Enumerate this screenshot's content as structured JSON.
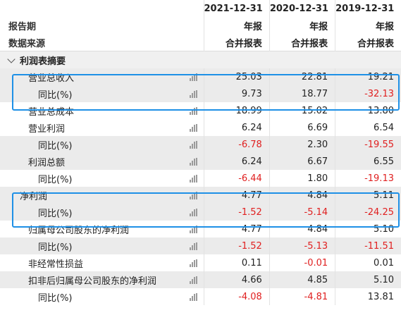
{
  "header": {
    "dates": [
      "2021-12-31",
      "2020-12-31",
      "2019-12-31"
    ],
    "period_label": "报告期",
    "period_values": [
      "年报",
      "年报",
      "年报"
    ],
    "source_label": "数据来源",
    "source_values": [
      "合并报表",
      "合并报表",
      "合并报表"
    ]
  },
  "section": {
    "title": "利润表摘要"
  },
  "rows": [
    {
      "label": "营业总收入",
      "values": [
        "25.03",
        "22.81",
        "19.21"
      ]
    },
    {
      "label": "同比(%)",
      "values": [
        "9.73",
        "18.77",
        "-32.13"
      ]
    },
    {
      "label": "营业总成本",
      "values": [
        "18.99",
        "15.02",
        "13.80"
      ]
    },
    {
      "label": "营业利润",
      "values": [
        "6.24",
        "6.69",
        "6.54"
      ]
    },
    {
      "label": "同比(%)",
      "values": [
        "-6.78",
        "2.30",
        "-19.55"
      ]
    },
    {
      "label": "利润总额",
      "values": [
        "6.24",
        "6.67",
        "6.55"
      ]
    },
    {
      "label": "同比(%)",
      "values": [
        "-6.44",
        "1.80",
        "-19.13"
      ]
    },
    {
      "label": "净利润",
      "values": [
        "4.77",
        "4.84",
        "5.11"
      ]
    },
    {
      "label": "同比(%)",
      "values": [
        "-1.52",
        "-5.14",
        "-24.25"
      ]
    },
    {
      "label": "归属母公司股东的净利润",
      "values": [
        "4.77",
        "4.84",
        "5.10"
      ]
    },
    {
      "label": "同比(%)",
      "values": [
        "-1.52",
        "-5.13",
        "-11.51"
      ]
    },
    {
      "label": "非经常性损益",
      "values": [
        "0.11",
        "-0.01",
        "0.01"
      ]
    },
    {
      "label": "扣非后归属母公司股东的净利润",
      "values": [
        "4.66",
        "4.85",
        "5.10"
      ]
    },
    {
      "label": "同比(%)",
      "values": [
        "-4.08",
        "-4.81",
        "13.81"
      ]
    }
  ],
  "icons": {
    "chart": "bar-chart-icon",
    "collapse": "chevron-down-icon"
  },
  "colors": {
    "negative": "#e02020",
    "highlight": "#1e90e6",
    "stripe": "#ebebeb"
  }
}
